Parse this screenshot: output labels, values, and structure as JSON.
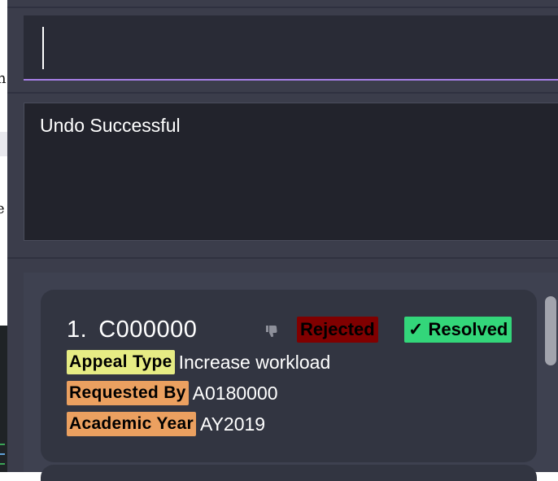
{
  "command_box": {
    "value": ""
  },
  "result_display": {
    "text": "Undo Successful"
  },
  "appeals": [
    {
      "index": "1.",
      "id": "C000000",
      "status_badge": "Rejected",
      "resolved_badge": "✓ Resolved",
      "fields": [
        {
          "label": "Appeal Type",
          "value": "Increase workload"
        },
        {
          "label": "Requested By",
          "value": "A0180000"
        },
        {
          "label": "Academic Year",
          "value": "AY2019"
        }
      ]
    }
  ],
  "colors": {
    "accent": "#a67fe6",
    "rejected": "#800000",
    "resolved": "#33d67a",
    "label_yellow": "#e6ec84",
    "label_orange": "#eba060"
  },
  "icons": {
    "status": "thumbs-down-icon"
  }
}
